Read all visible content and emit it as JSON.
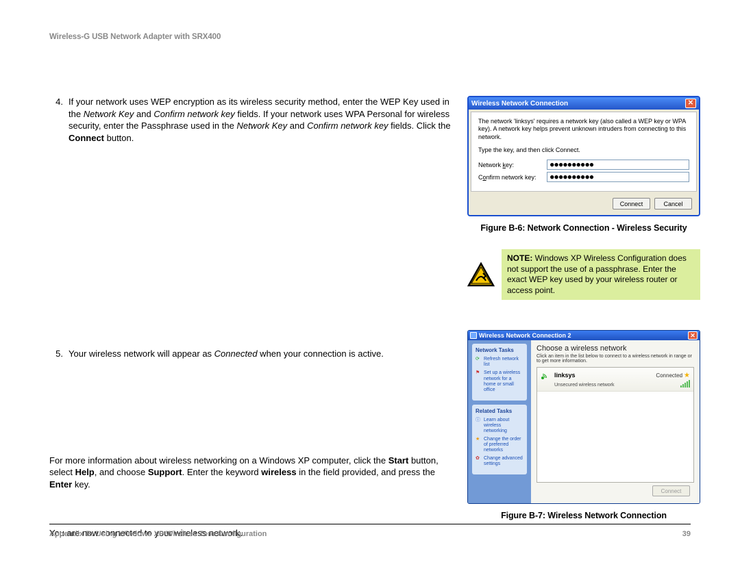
{
  "header": {
    "title": "Wireless-G USB Network Adapter with SRX400"
  },
  "step4": {
    "num": "4.",
    "text_a": "If your network uses WEP encryption as its wireless security method, enter the WEP Key used in the ",
    "em1": "Network Key",
    "text_b": " and ",
    "em2": "Confirm network key",
    "text_c": " fields. If your network uses WPA Personal for wireless security, enter the Passphrase used in the ",
    "em3": "Network Key",
    "text_d": " and ",
    "em4": "Confirm network key",
    "text_e": " fields. Click the ",
    "bold1": "Connect",
    "text_f": " button."
  },
  "step5": {
    "num": "5.",
    "text_a": "Your wireless network will appear as ",
    "em1": "Connected",
    "text_b": " when your connection is active."
  },
  "para1": {
    "a": "For more information about wireless networking on a Windows XP computer, click the ",
    "b1": "Start",
    "b": " button, select ",
    "b2": "Help",
    "c": ", and choose ",
    "b3": "Support",
    "d": ". Enter the keyword ",
    "b4": "wireless",
    "e": " in the field provided, and press the ",
    "b5": "Enter",
    "f": " key."
  },
  "para2": "You are now connected to your wireless network.",
  "dialog1": {
    "title": "Wireless Network Connection",
    "body1": "The network 'linksys' requires a network key (also called a WEP key or WPA key). A network key helps prevent unknown intruders from connecting to this network.",
    "body2": "Type the key, and then click Connect.",
    "label1_a": "Network ",
    "label1_u": "k",
    "label1_b": "ey:",
    "label2_a": "C",
    "label2_u": "o",
    "label2_b": "nfirm network key:",
    "dots": "●●●●●●●●●●",
    "btn_connect": "Connect",
    "btn_cancel": "Cancel"
  },
  "caption1": "Figure B-6: Network Connection - Wireless Security",
  "note": {
    "lead": "NOTE:",
    "text": " Windows XP Wireless Configuration does not support the use of a passphrase. Enter the exact WEP key used by your wireless router or access point."
  },
  "dialog2": {
    "title": "Wireless Network Connection 2",
    "side_hd1": "Network Tasks",
    "side_i1": "Refresh network list",
    "side_i2": "Set up a wireless network for a home or small office",
    "side_hd2": "Related Tasks",
    "side_i3": "Learn about wireless networking",
    "side_i4": "Change the order of preferred networks",
    "side_i5": "Change advanced settings",
    "main_hd": "Choose a wireless network",
    "main_sub": "Click an item in the list below to connect to a wireless network in range or to get more information.",
    "net_name": "linksys",
    "net_status": "Connected",
    "net_type": "Unsecured wireless network",
    "btn": "Connect"
  },
  "caption2": "Figure B-7: Wireless Network Connection",
  "footer": {
    "left": "Appendix B: Using Windows XP Wireless Zero Configuration",
    "right": "39"
  }
}
